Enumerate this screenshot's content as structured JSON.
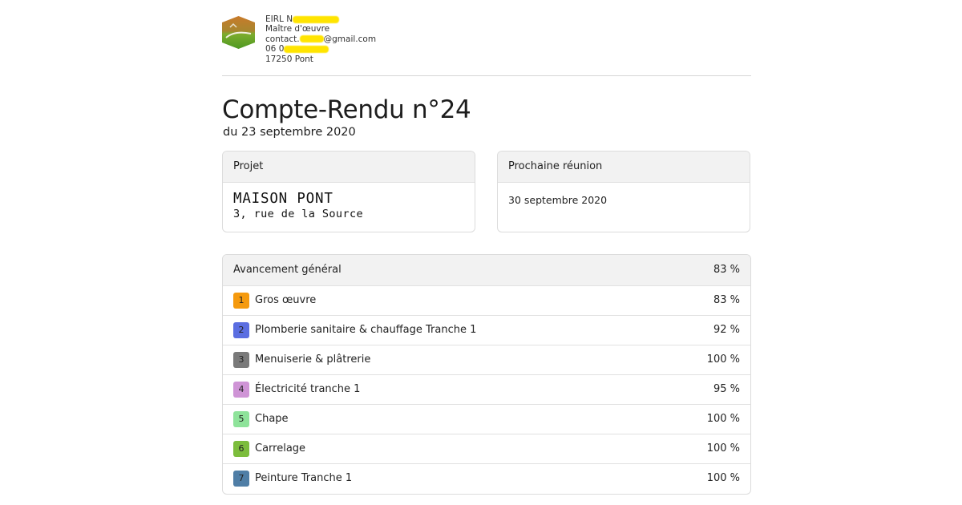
{
  "header": {
    "company_prefix": "EIRL N",
    "role": "Maître d'œuvre",
    "email_prefix": "contact.",
    "email_suffix": "@gmail.com",
    "phone_prefix": "06 0",
    "city": "17250 Pont"
  },
  "title": "Compte-Rendu n°24",
  "subtitle": "du 23 septembre 2020",
  "project_card": {
    "label": "Projet",
    "name": "MAISON PONT",
    "address": "3, rue de la Source"
  },
  "next_meeting_card": {
    "label": "Prochaine réunion",
    "date": "30 septembre 2020"
  },
  "progress": {
    "header": {
      "label": "Avancement général",
      "value": "83 %"
    },
    "items": [
      {
        "num": "1",
        "label": "Gros œuvre",
        "value": "83 %",
        "color": "#f59a0e"
      },
      {
        "num": "2",
        "label": "Plomberie sanitaire & chauffage Tranche 1",
        "value": "92 %",
        "color": "#5b6ee1"
      },
      {
        "num": "3",
        "label": "Menuiserie & plâtrerie",
        "value": "100 %",
        "color": "#7a7a7a"
      },
      {
        "num": "4",
        "label": "Électricité tranche 1",
        "value": "95 %",
        "color": "#cf94d6"
      },
      {
        "num": "5",
        "label": "Chape",
        "value": "100 %",
        "color": "#8ee39a"
      },
      {
        "num": "6",
        "label": "Carrelage",
        "value": "100 %",
        "color": "#7cbd3c"
      },
      {
        "num": "7",
        "label": "Peinture Tranche 1",
        "value": "100 %",
        "color": "#4f7ea6"
      }
    ]
  },
  "colors": {
    "logo_green": "#6aa72c",
    "logo_orange": "#c4782e",
    "redaction": "#ffe400"
  }
}
